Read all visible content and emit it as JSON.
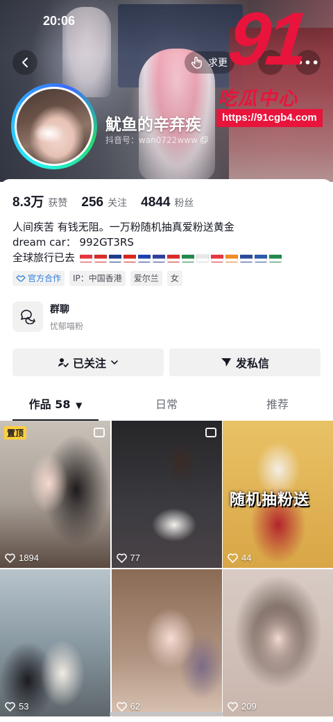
{
  "status_bar": {
    "time": "20:06"
  },
  "header": {
    "search_label": "求更",
    "more_label": "•••"
  },
  "watermark": {
    "number": "91",
    "text": "吃瓜中心",
    "url": "https://91cgb4.com"
  },
  "profile": {
    "nickname": "魷鱼的辛弃疾",
    "douyin_id": "抖音号：wan0722www",
    "stats": [
      {
        "value": "8.3万",
        "label": "获赞"
      },
      {
        "value": "256",
        "label": "关注"
      },
      {
        "value": "4844",
        "label": "粉丝"
      }
    ],
    "bio_lines": [
      "人间疾苦 有钱无阻。一万粉随机抽真爱粉送黄金",
      "dream car：  992GT3RS",
      "全球旅行已去"
    ],
    "flag_colors": [
      "#e8353f",
      "#d92b2b",
      "#1e3a8a",
      "#da251d",
      "#1e40af",
      "#2f3e9e",
      "#d92b2b",
      "#1f8a4c",
      "#e8e8e8",
      "#e8353f",
      "#f28b22",
      "#2b4a9c",
      "#2a5aa8",
      "#1f8a4c"
    ],
    "tags": [
      "官方合作",
      "IP：中国香港",
      "爱尔兰",
      "女"
    ]
  },
  "group_chat": {
    "title": "群聊",
    "subtitle": "忧郁喵粉"
  },
  "actions": {
    "follow_label": "已关注",
    "message_label": "发私信"
  },
  "tabs": [
    {
      "label": "作品 58",
      "active": true
    },
    {
      "label": "日常",
      "active": false
    },
    {
      "label": "推荐",
      "active": false
    }
  ],
  "videos": [
    {
      "likes": "1894",
      "pinned_label": "置顶",
      "multi": true
    },
    {
      "likes": "77",
      "multi": true
    },
    {
      "likes": "44",
      "overlay": "随机抽粉送"
    },
    {
      "likes": "53"
    },
    {
      "likes": "62"
    },
    {
      "likes": "209"
    }
  ]
}
